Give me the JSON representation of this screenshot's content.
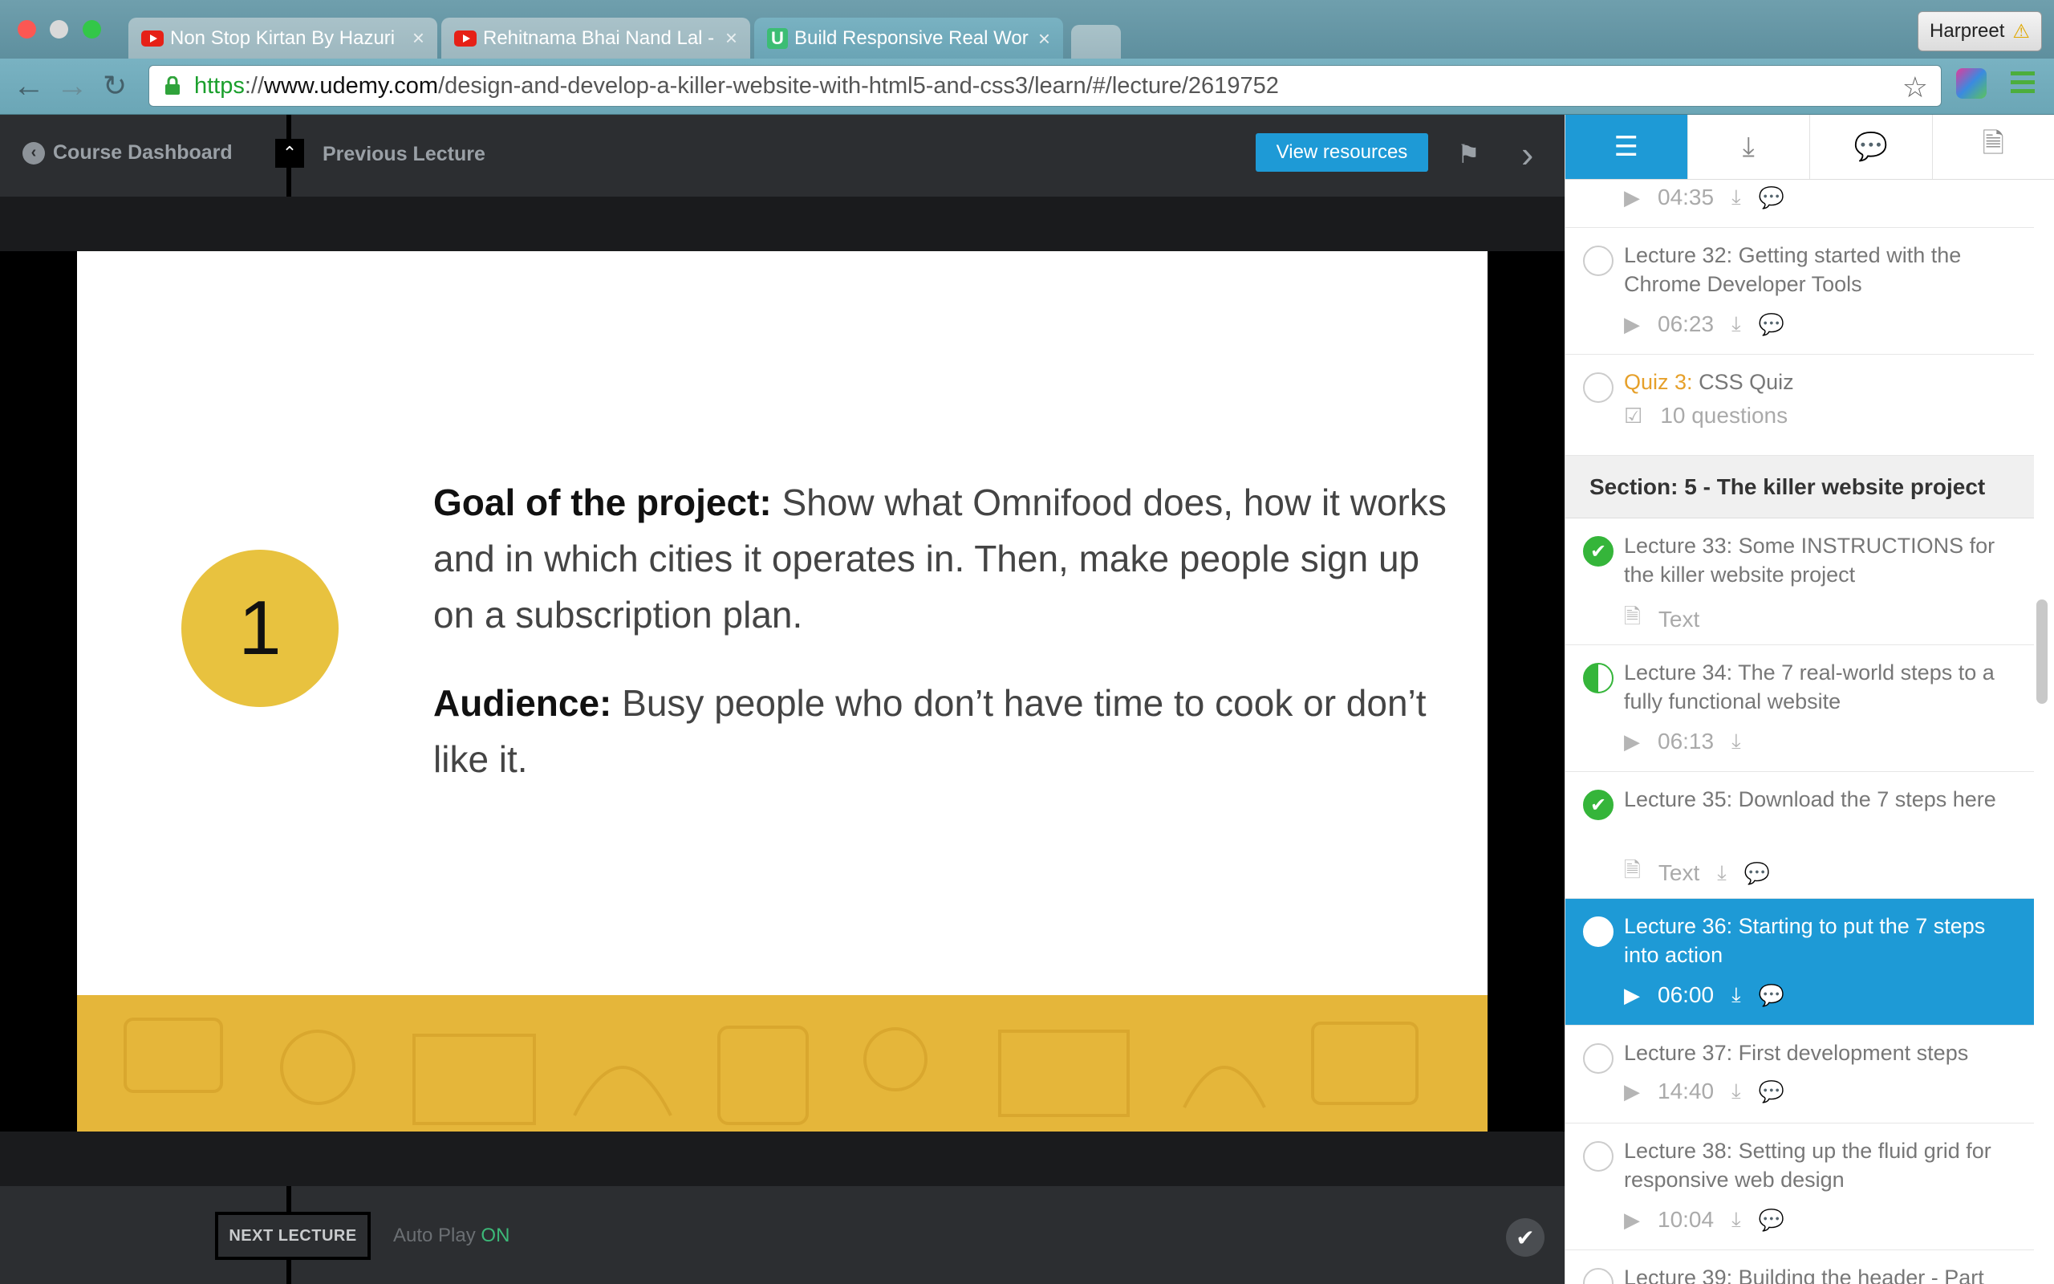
{
  "browser": {
    "tabs": [
      {
        "title": "Non Stop Kirtan By Hazuri",
        "favicon": "youtube-icon",
        "active": false
      },
      {
        "title": "Rehitnama Bhai Nand Lal -",
        "favicon": "youtube-icon",
        "active": false
      },
      {
        "title": "Build Responsive Real Wor",
        "favicon": "udemy-icon",
        "active": true
      }
    ],
    "profile_name": "Harpreet",
    "url_scheme": "https",
    "url_sep": "://",
    "url_domain": "www.udemy.com",
    "url_path": "/design-and-develop-a-killer-website-with-html5-and-css3/learn/#/lecture/2619752"
  },
  "player": {
    "course_dashboard": "Course Dashboard",
    "previous_lecture": "Previous Lecture",
    "view_resources": "View resources",
    "next_lecture": "NEXT LECTURE",
    "autoplay_label": "Auto Play",
    "autoplay_state": "ON"
  },
  "slide": {
    "step_number": "1",
    "goal_heading": "Goal of the project:",
    "goal_text": " Show what Omnifood does, how it works and in which cities it operates in. Then, make people sign up on a subscription plan.",
    "audience_heading": "Audience:",
    "audience_text": " Busy people who don’t have time to cook or don’t like it."
  },
  "sidebar": {
    "tabs": [
      "list-icon",
      "download-icon",
      "comments-icon",
      "notes-icon"
    ],
    "section_title": "Section: 5 - The killer website project",
    "items": [
      {
        "title": "",
        "meta": "04:35",
        "type": "video"
      },
      {
        "title": "Lecture 32: Getting started with the Chrome Developer Tools",
        "meta": "06:23",
        "type": "video"
      },
      {
        "quiz_label": "Quiz 3:",
        "title": "CSS Quiz",
        "meta": "10 questions",
        "type": "quiz"
      },
      {
        "title": "Lecture 33: Some INSTRUCTIONS for the killer website project",
        "meta": "Text",
        "type": "text"
      },
      {
        "title": "Lecture 34: The 7 real-world steps to a fully functional website",
        "meta": "06:13",
        "type": "video"
      },
      {
        "title": "Lecture 35: Download the 7 steps here",
        "meta": "Text",
        "type": "text"
      },
      {
        "title": "Lecture 36: Starting to put the 7 steps into action",
        "meta": "06:00",
        "type": "video"
      },
      {
        "title": "Lecture 37: First development steps",
        "meta": "14:40",
        "type": "video"
      },
      {
        "title": "Lecture 38: Setting up the fluid grid for responsive web design",
        "meta": "10:04",
        "type": "video"
      },
      {
        "title": "Lecture 39: Building the header - Part",
        "meta": "",
        "type": "video"
      }
    ]
  },
  "colors": {
    "accent": "#1e9ad6",
    "complete": "#35b53a",
    "quiz": "#e6a02a",
    "slide_yellow": "#e5b63a"
  }
}
